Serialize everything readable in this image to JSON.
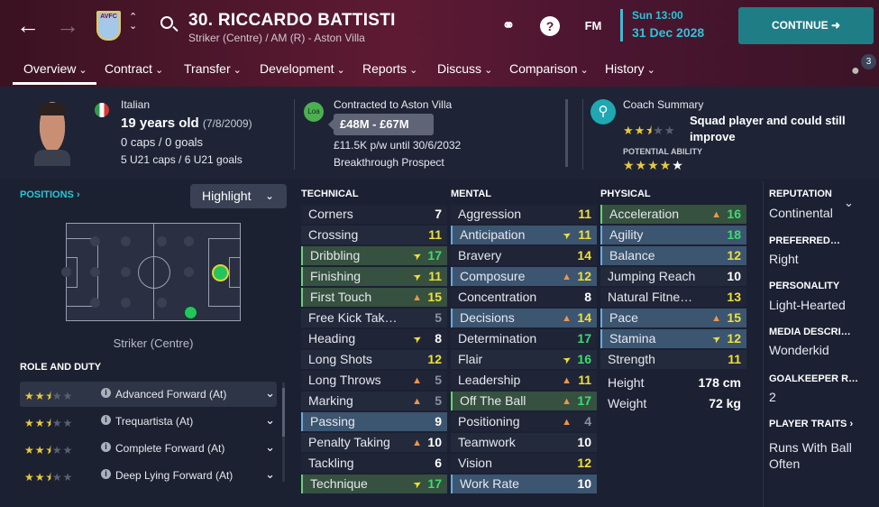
{
  "header": {
    "crest_text": "AVFC",
    "player_title": "30. RICCARDO BATTISTI",
    "player_subtitle": "Striker (Centre) / AM (R) - Aston Villa",
    "fm_label": "FM",
    "help_label": "?",
    "time": "Sun 13:00",
    "date": "31 Dec 2028",
    "continue_label": "CONTINUE"
  },
  "tabs": [
    "Overview",
    "Contract",
    "Transfer",
    "Development",
    "Reports",
    "Discuss",
    "Comparison",
    "History"
  ],
  "notifications": {
    "count": "3"
  },
  "info": {
    "nationality": "Italian",
    "age": "19 years old",
    "dob": "(7/8/2009)",
    "caps": "0 caps / 0 goals",
    "u21": "5 U21 caps / 6 U21 goals",
    "loan_badge": "Loa",
    "contract_title": "Contracted to Aston Villa",
    "value": "£48M - £67M",
    "wage": "£11.5K p/w until 30/6/2032",
    "prospect": "Breakthrough Prospect",
    "coach_title": "Coach Summary",
    "coach_text": "Squad player and could still improve",
    "potential_label": "POTENTIAL ABILITY",
    "current_stars": 2.5,
    "potential_stars": 4.5
  },
  "positions": {
    "title": "POSITIONS",
    "highlight_label": "Highlight",
    "caption": "Striker (Centre)"
  },
  "roles": {
    "title": "ROLE AND DUTY",
    "items": [
      {
        "label": "Advanced Forward (At)",
        "stars": 2.5
      },
      {
        "label": "Trequartista (At)",
        "stars": 2.5
      },
      {
        "label": "Complete Forward (At)",
        "stars": 2.5
      },
      {
        "label": "Deep Lying Forward (At)",
        "stars": 2.5
      }
    ]
  },
  "technical": {
    "title": "TECHNICAL",
    "items": [
      {
        "n": "Corners",
        "v": "7",
        "c": "w",
        "s": "",
        "a": ""
      },
      {
        "n": "Crossing",
        "v": "11",
        "c": "y",
        "s": "",
        "a": ""
      },
      {
        "n": "Dribbling",
        "v": "17",
        "c": "g",
        "s": "grn",
        "a": "up"
      },
      {
        "n": "Finishing",
        "v": "11",
        "c": "y",
        "s": "grn",
        "a": "up"
      },
      {
        "n": "First Touch",
        "v": "15",
        "c": "y",
        "s": "grn",
        "a": "dn"
      },
      {
        "n": "Free Kick Tak…",
        "v": "5",
        "c": "gr",
        "s": "",
        "a": ""
      },
      {
        "n": "Heading",
        "v": "8",
        "c": "w",
        "s": "",
        "a": "up"
      },
      {
        "n": "Long Shots",
        "v": "12",
        "c": "y",
        "s": "",
        "a": ""
      },
      {
        "n": "Long Throws",
        "v": "5",
        "c": "gr",
        "s": "",
        "a": "dn"
      },
      {
        "n": "Marking",
        "v": "5",
        "c": "gr",
        "s": "",
        "a": "dn"
      },
      {
        "n": "Passing",
        "v": "9",
        "c": "w",
        "s": "hi",
        "a": ""
      },
      {
        "n": "Penalty Taking",
        "v": "10",
        "c": "w",
        "s": "",
        "a": "dn"
      },
      {
        "n": "Tackling",
        "v": "6",
        "c": "w",
        "s": "",
        "a": ""
      },
      {
        "n": "Technique",
        "v": "17",
        "c": "g",
        "s": "grn",
        "a": "up"
      }
    ]
  },
  "mental": {
    "title": "MENTAL",
    "items": [
      {
        "n": "Aggression",
        "v": "11",
        "c": "y",
        "s": "",
        "a": ""
      },
      {
        "n": "Anticipation",
        "v": "11",
        "c": "y",
        "s": "hi",
        "a": "up"
      },
      {
        "n": "Bravery",
        "v": "14",
        "c": "y",
        "s": "",
        "a": ""
      },
      {
        "n": "Composure",
        "v": "12",
        "c": "y",
        "s": "hi",
        "a": "dn"
      },
      {
        "n": "Concentration",
        "v": "8",
        "c": "w",
        "s": "",
        "a": ""
      },
      {
        "n": "Decisions",
        "v": "14",
        "c": "y",
        "s": "hi",
        "a": "dn"
      },
      {
        "n": "Determination",
        "v": "17",
        "c": "g",
        "s": "",
        "a": ""
      },
      {
        "n": "Flair",
        "v": "16",
        "c": "g",
        "s": "",
        "a": "up"
      },
      {
        "n": "Leadership",
        "v": "11",
        "c": "y",
        "s": "",
        "a": "dn"
      },
      {
        "n": "Off The Ball",
        "v": "17",
        "c": "g",
        "s": "grn",
        "a": "dn"
      },
      {
        "n": "Positioning",
        "v": "4",
        "c": "gr",
        "s": "",
        "a": "dn"
      },
      {
        "n": "Teamwork",
        "v": "10",
        "c": "w",
        "s": "",
        "a": ""
      },
      {
        "n": "Vision",
        "v": "12",
        "c": "y",
        "s": "",
        "a": ""
      },
      {
        "n": "Work Rate",
        "v": "10",
        "c": "w",
        "s": "hi",
        "a": ""
      }
    ]
  },
  "physical": {
    "title": "PHYSICAL",
    "items": [
      {
        "n": "Acceleration",
        "v": "16",
        "c": "g",
        "s": "grn",
        "a": "dn"
      },
      {
        "n": "Agility",
        "v": "18",
        "c": "g",
        "s": "hi",
        "a": ""
      },
      {
        "n": "Balance",
        "v": "12",
        "c": "y",
        "s": "hi",
        "a": ""
      },
      {
        "n": "Jumping Reach",
        "v": "10",
        "c": "w",
        "s": "",
        "a": ""
      },
      {
        "n": "Natural Fitne…",
        "v": "13",
        "c": "y",
        "s": "",
        "a": ""
      },
      {
        "n": "Pace",
        "v": "15",
        "c": "y",
        "s": "hi",
        "a": "dn"
      },
      {
        "n": "Stamina",
        "v": "12",
        "c": "y",
        "s": "hi",
        "a": "up"
      },
      {
        "n": "Strength",
        "v": "11",
        "c": "y",
        "s": "",
        "a": ""
      }
    ],
    "height_label": "Height",
    "height": "178 cm",
    "weight_label": "Weight",
    "weight": "72 kg"
  },
  "right_panel": {
    "reputation_title": "REPUTATION",
    "reputation": "Continental",
    "foot_title": "PREFERRED…",
    "foot": "Right",
    "personality_title": "PERSONALITY",
    "personality": "Light-Hearted",
    "media_title": "MEDIA DESCRI…",
    "media": "Wonderkid",
    "gk_title": "GOALKEEPER R…",
    "gk": "2",
    "traits_title": "PLAYER TRAITS",
    "traits": "Runs With Ball Often"
  }
}
